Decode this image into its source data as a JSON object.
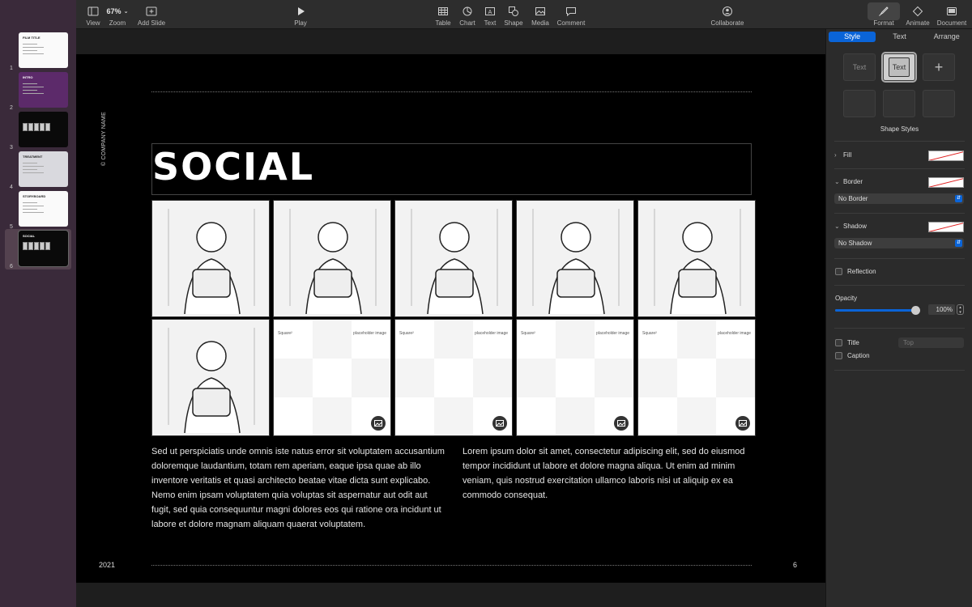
{
  "toolbar": {
    "view": "View",
    "zoom_value": "67%",
    "zoom": "Zoom",
    "add_slide": "Add Slide",
    "play": "Play",
    "table": "Table",
    "chart": "Chart",
    "text": "Text",
    "shape": "Shape",
    "media": "Media",
    "comment": "Comment",
    "collaborate": "Collaborate",
    "format": "Format",
    "animate": "Animate",
    "document": "Document"
  },
  "navigator": {
    "slides": [
      {
        "number": "1",
        "style": "white",
        "title": "FILM TITLE"
      },
      {
        "number": "2",
        "style": "purple",
        "title": "INTRO"
      },
      {
        "number": "3",
        "style": "black",
        "title": ""
      },
      {
        "number": "4",
        "style": "gray",
        "title": "TREATMENT"
      },
      {
        "number": "5",
        "style": "white",
        "title": "STORYBOARD"
      },
      {
        "number": "6",
        "style": "black",
        "title": "SOCIAL",
        "selected": true
      }
    ]
  },
  "slide": {
    "company": "© COMPANY NAME",
    "title": "SOCIAL",
    "placeholder_left": "Square²",
    "placeholder_right": "placeholder image",
    "paragraph_left": "Sed ut perspiciatis unde omnis iste natus error sit voluptatem accusantium doloremque laudantium, totam rem aperiam, eaque ipsa quae ab illo inventore veritatis et quasi architecto beatae vitae dicta sunt explicabo. Nemo enim ipsam voluptatem quia voluptas sit aspernatur aut odit aut fugit, sed quia consequuntur magni dolores eos qui ratione ora incidunt ut labore et dolore magnam aliquam quaerat voluptatem.",
    "paragraph_right": "Lorem ipsum dolor sit amet, consectetur adipiscing elit, sed do eiusmod tempor incididunt ut labore et dolore magna aliqua. Ut enim ad minim veniam, quis nostrud exercitation ullamco laboris nisi ut aliquip ex ea commodo consequat.",
    "year": "2021",
    "page_number": "6"
  },
  "inspector": {
    "tabs": [
      "Style",
      "Text",
      "Arrange"
    ],
    "active_tab": "Style",
    "style_text_1": "Text",
    "style_text_2": "Text",
    "shape_styles": "Shape Styles",
    "fill": "Fill",
    "border": "Border",
    "border_value": "No Border",
    "shadow": "Shadow",
    "shadow_value": "No Shadow",
    "reflection": "Reflection",
    "opacity": "Opacity",
    "opacity_value": "100%",
    "opacity_level": 1.0,
    "title": "Title",
    "title_position": "Top",
    "caption": "Caption"
  },
  "colors": {
    "accent": "#0a64d8",
    "navigator_bg": "#3a2a3a",
    "slide_bg": "#000000"
  }
}
